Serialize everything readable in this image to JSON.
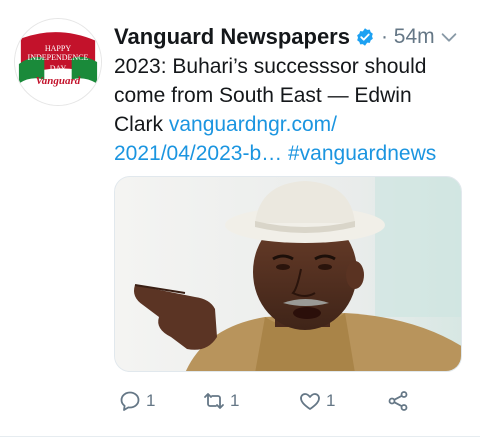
{
  "avatar": {
    "line1": "HAPPY",
    "line2": "INDEPENDENCE",
    "line3": "DAY",
    "line4": "FROM",
    "brand": "Vanguard"
  },
  "header": {
    "name": "Vanguard Newspapers",
    "verified_icon": "verified-badge-icon",
    "meta": "· 54m"
  },
  "tweet": {
    "text": "2023: Buhari’s successsor should come from South East — Edwin Clark ",
    "link": "vanguardngr.com/ 2021/04/2023-b…",
    "hashtag": " #vanguardnews"
  },
  "actions": {
    "reply_count": "1",
    "retweet_count": "1",
    "like_count": "1"
  },
  "colors": {
    "link": "#1b95e0",
    "muted": "#657786",
    "text": "#14171a",
    "brand_red": "#c3122b"
  }
}
